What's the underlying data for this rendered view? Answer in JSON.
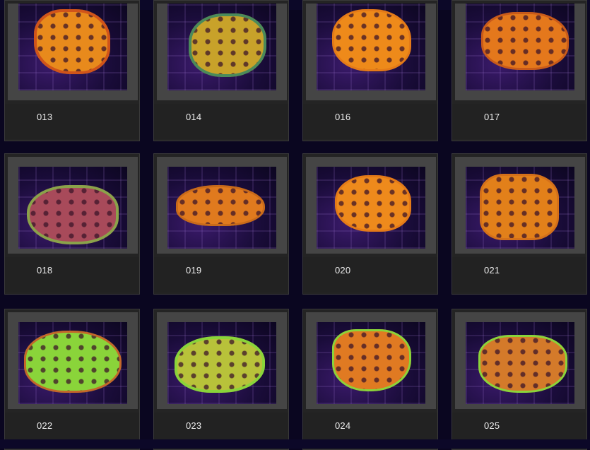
{
  "gallery": {
    "items": [
      {
        "label": "013",
        "coral_color": "#e88a1c",
        "rim_color": "#d0541a"
      },
      {
        "label": "014",
        "coral_color": "#c8a22a",
        "rim_color": "#4a8a5a"
      },
      {
        "label": "016",
        "coral_color": "#ee8a1a",
        "rim_color": "#e47a18"
      },
      {
        "label": "017",
        "coral_color": "#e4781c",
        "rim_color": "#c85a1a"
      },
      {
        "label": "018",
        "coral_color": "#a84a5a",
        "rim_color": "#8aa24a"
      },
      {
        "label": "019",
        "coral_color": "#e07a1e",
        "rim_color": "#c86a1a"
      },
      {
        "label": "020",
        "coral_color": "#ee8a1c",
        "rim_color": "#e47a18"
      },
      {
        "label": "021",
        "coral_color": "#e2801a",
        "rim_color": "#d4701a"
      },
      {
        "label": "022",
        "coral_color": "#8ad43a",
        "rim_color": "#c4662a"
      },
      {
        "label": "023",
        "coral_color": "#b8c23a",
        "rim_color": "#8ad43a"
      },
      {
        "label": "024",
        "coral_color": "#e07a22",
        "rim_color": "#8ad43a"
      },
      {
        "label": "025",
        "coral_color": "#d47a2a",
        "rim_color": "#8ad43a"
      }
    ]
  }
}
